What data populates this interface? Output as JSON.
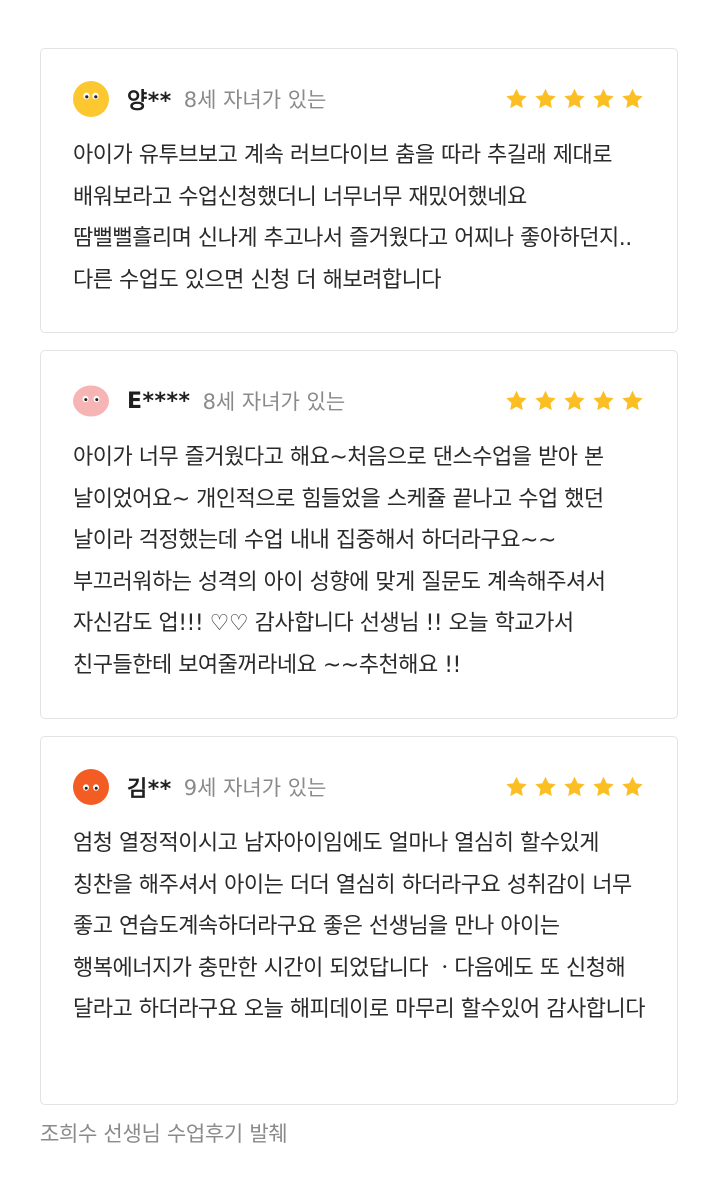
{
  "colors": {
    "star": "#FBBF24",
    "avatar_yellow": "#FDC82F",
    "avatar_pink": "#F6B4B4",
    "avatar_orange": "#F35C22",
    "card_border": "#E3E3E3",
    "meta_text": "#8A8A8A"
  },
  "reviews": [
    {
      "avatar_icon": "yellow-face-icon",
      "name": "양**",
      "meta": "8세 자녀가 있는",
      "rating": 5,
      "text": "아이가 유투브보고 계속 러브다이브 춤을 따라 추길래 제대로 배워보라고 수업신청했더니 너무너무 재밌어했네요 땀뻘뻘흘리며 신나게 추고나서 즐거웠다고 어찌나 좋아하던지.. 다른 수업도 있으면 신청 더 해보려합니다"
    },
    {
      "avatar_icon": "pink-face-icon",
      "name": "E****",
      "meta": "8세 자녀가 있는",
      "rating": 5,
      "text": "아이가 너무 즐거웠다고 해요~처음으로 댄스수업을 받아 본 날이었어요~ 개인적으로 힘들었을 스케쥴 끝나고 수업 했던 날이라 걱정했는데 수업 내내 집중해서 하더라구요~~ 부끄러워하는 성격의 아이 성향에 맞게 질문도 계속해주셔서 자신감도 업!!! ♡♡ 감사합니다 선생님 !! 오늘 학교가서 친구들한테 보여줄꺼라네요 ~~추천해요 !!"
    },
    {
      "avatar_icon": "orange-face-icon",
      "name": "김**",
      "meta": "9세 자녀가 있는",
      "rating": 5,
      "text": "엄청 열정적이시고 남자아이임에도 얼마나 열심히 할수있게 칭찬을 해주셔서 아이는 더더 열심히 하더라구요 성취감이 너무 좋고 연습도계속하더라구요 좋은 선생님을 만나 아이는 행복에너지가 충만한 시간이 되었답니다 ㆍ다음에도 또 신청해 달라고 하더라구요 오늘 해피데이로 마무리 할수있어 감사합니다"
    }
  ],
  "footer": {
    "caption": "조희수 선생님 수업후기 발췌"
  }
}
